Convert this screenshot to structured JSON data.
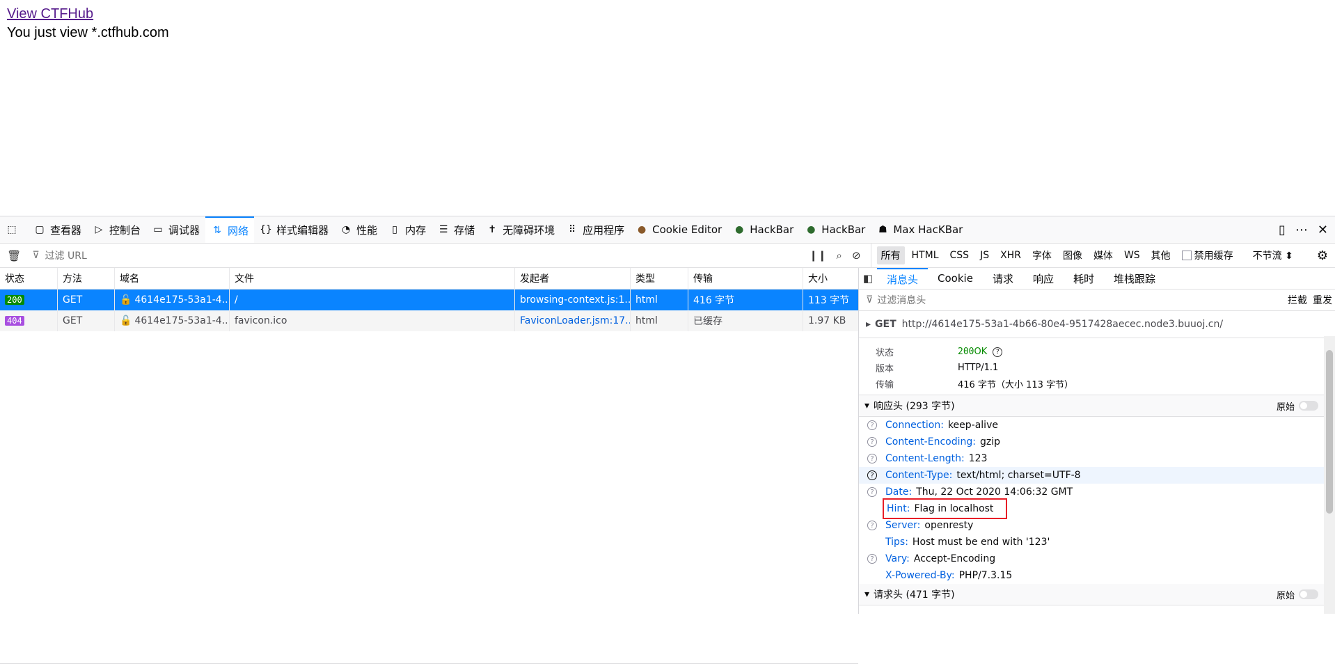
{
  "page": {
    "link_text": "View CTFHub",
    "message": "You just view *.ctfhub.com"
  },
  "devtools": {
    "tabs": [
      {
        "icon": "inspector-icon",
        "label": "查看器"
      },
      {
        "icon": "console-icon",
        "label": "控制台"
      },
      {
        "icon": "debugger-icon",
        "label": "调试器"
      },
      {
        "icon": "network-icon",
        "label": "网络"
      },
      {
        "icon": "style-editor-icon",
        "label": "样式编辑器"
      },
      {
        "icon": "performance-icon",
        "label": "性能"
      },
      {
        "icon": "memory-icon",
        "label": "内存"
      },
      {
        "icon": "storage-icon",
        "label": "存储"
      },
      {
        "icon": "accessibility-icon",
        "label": "无障碍环境"
      },
      {
        "icon": "application-icon",
        "label": "应用程序"
      },
      {
        "icon": "cookie-icon",
        "label": "Cookie Editor"
      },
      {
        "icon": "hackbar-icon",
        "label": "HackBar"
      },
      {
        "icon": "hackbar-icon",
        "label": "HackBar"
      },
      {
        "icon": "max-hackbar-icon",
        "label": "Max HacKBar"
      }
    ],
    "filter_placeholder": "过滤 URL",
    "type_filters": [
      "所有",
      "HTML",
      "CSS",
      "JS",
      "XHR",
      "字体",
      "图像",
      "媒体",
      "WS",
      "其他"
    ],
    "disable_cache": "禁用缓存",
    "throttle": "不节流 ⬍",
    "columns": [
      "状态",
      "方法",
      "域名",
      "文件",
      "发起者",
      "类型",
      "传输",
      "大小"
    ],
    "requests": [
      {
        "status": "200",
        "method": "GET",
        "domain": "4614e175-53a1-4...",
        "file": "/",
        "initiator": "browsing-context.js:1...",
        "type": "html",
        "transfer": "416 字节",
        "size": "113 字节"
      },
      {
        "status": "404",
        "method": "GET",
        "domain": "4614e175-53a1-4...",
        "file": "favicon.ico",
        "initiator": "FaviconLoader.jsm:17...",
        "type": "html",
        "transfer": "已缓存",
        "size": "1.97 KB"
      }
    ],
    "detail": {
      "tabs": [
        "消息头",
        "Cookie",
        "请求",
        "响应",
        "耗时",
        "堆栈跟踪"
      ],
      "filter_placeholder": "过滤消息头",
      "block": "拦截",
      "resend": "重发",
      "method": "GET",
      "url": "http://4614e175-53a1-4b66-80e4-9517428aecec.node3.buuoj.cn/",
      "summary": {
        "status_label": "状态",
        "status_code": "200",
        "status_text": "OK",
        "version_label": "版本",
        "version": "HTTP/1.1",
        "transfer_label": "传输",
        "transfer": "416 字节（大小 113 字节）"
      },
      "response_section": "响应头 (293 字节)",
      "raw_label": "原始",
      "response_headers": [
        {
          "name": "Connection:",
          "value": "keep-alive"
        },
        {
          "name": "Content-Encoding:",
          "value": "gzip"
        },
        {
          "name": "Content-Length:",
          "value": "123"
        },
        {
          "name": "Content-Type:",
          "value": "text/html; charset=UTF-8"
        },
        {
          "name": "Date:",
          "value": "Thu, 22 Oct 2020 14:06:32 GMT"
        },
        {
          "name": "Hint:",
          "value": "Flag in localhost"
        },
        {
          "name": "Server:",
          "value": "openresty"
        },
        {
          "name": "Tips:",
          "value": "Host must be end with '123'"
        },
        {
          "name": "Vary:",
          "value": "Accept-Encoding"
        },
        {
          "name": "X-Powered-By:",
          "value": "PHP/7.3.15"
        }
      ],
      "request_section": "请求头 (471 字节)"
    }
  }
}
